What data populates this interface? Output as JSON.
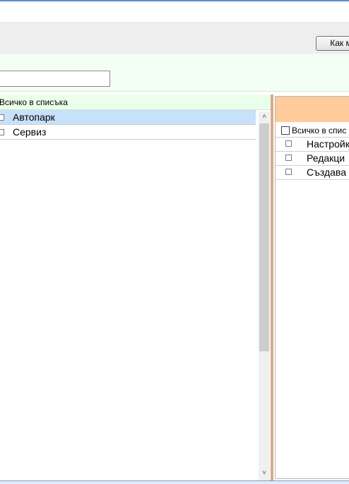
{
  "toolbar": {
    "help_label": "Как м"
  },
  "filter": {
    "value": "",
    "placeholder": ""
  },
  "left_panel": {
    "select_all_label": "Всичко в списъка",
    "items": [
      {
        "label": "Автопарк",
        "selected": true,
        "checked": false
      },
      {
        "label": "Сервиз",
        "selected": false,
        "checked": false
      }
    ],
    "scroll_up_glyph": "˄",
    "scroll_down_glyph": "˅"
  },
  "right_panel": {
    "select_all_label": "Всичко в спис",
    "items": [
      {
        "label": "Настройк",
        "checked": false
      },
      {
        "label": "Редакци",
        "checked": false
      },
      {
        "label": "Създава",
        "checked": false
      }
    ]
  },
  "colors": {
    "selected_row": "#c7e1fb",
    "left_header_bg": "#eaffea",
    "right_header_bg": "#ffcb9a",
    "splitter": "#d8ab85"
  }
}
